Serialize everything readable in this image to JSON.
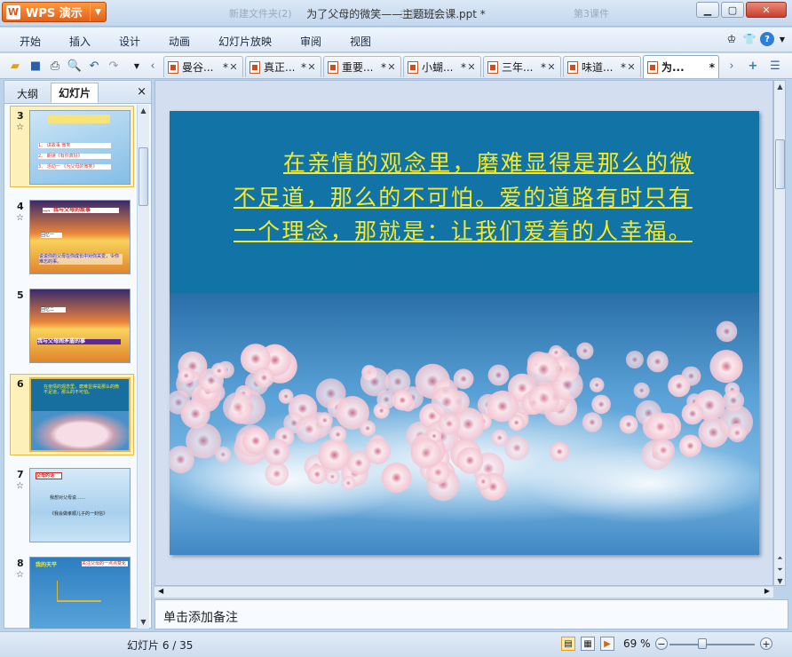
{
  "app": {
    "name": "WPS 演示",
    "logo_letter": "W"
  },
  "window": {
    "title": "为了父母的微笑——主题班会课.ppt *",
    "ghost_tabs": [
      "新建文件夹(2)",
      "主题班会",
      "第3课件"
    ]
  },
  "menu": [
    "开始",
    "插入",
    "设计",
    "动画",
    "幻灯片放映",
    "审阅",
    "视图"
  ],
  "doc_tabs": [
    {
      "label": "曼谷...",
      "modified": "*",
      "active": false
    },
    {
      "label": "真正...",
      "modified": "*",
      "active": false
    },
    {
      "label": "重要...",
      "modified": "*",
      "active": false
    },
    {
      "label": "小蝴...",
      "modified": "*",
      "active": false
    },
    {
      "label": "三年...",
      "modified": "*",
      "active": false
    },
    {
      "label": "味道...",
      "modified": "*",
      "active": false
    },
    {
      "label": "为...",
      "modified": "*",
      "active": true
    }
  ],
  "sidepanel": {
    "tab_outline": "大纲",
    "tab_slides": "幻灯片",
    "close": "×"
  },
  "thumbnails": [
    {
      "num": "3",
      "star": "☆",
      "lines": [
        "1、 讲故事 微笑",
        "2、 朗读《有你真好》",
        "3、 活动一 《为父母的微笑》"
      ]
    },
    {
      "num": "4",
      "star": "☆",
      "lines": [
        "二、我与父母的故事",
        "回忆一",
        "说说你的父母在你成长中对你关爱，令你难忘的事。"
      ]
    },
    {
      "num": "5",
      "star": "",
      "lines": [
        "回忆二",
        "我与父母闹矛盾的事"
      ]
    },
    {
      "num": "6",
      "star": "",
      "lines": [
        "在亲情的观念里，磨难显得是那么的微不足道，那么的不可怕。"
      ]
    },
    {
      "num": "7",
      "star": "☆",
      "lines": [
        "父母的话",
        "我想对父母说……",
        "《我会做孝顺儿子的一封信》"
      ]
    },
    {
      "num": "8",
      "star": "☆",
      "lines": [
        "我的天平",
        "关注父母的一点点变化"
      ]
    }
  ],
  "slide": {
    "text": "在亲情的观念里，磨难显得是那么的微不足道，那么的不可怕。爱的道路有时只有一个理念，那就是：让我们爱着的人幸福。",
    "text_color": "#f5ea2a",
    "bg_color": "#1273a6"
  },
  "notes_placeholder": "单击添加备注",
  "status": {
    "slide_info": "幻灯片 6 / 35",
    "zoom": "69 %"
  }
}
